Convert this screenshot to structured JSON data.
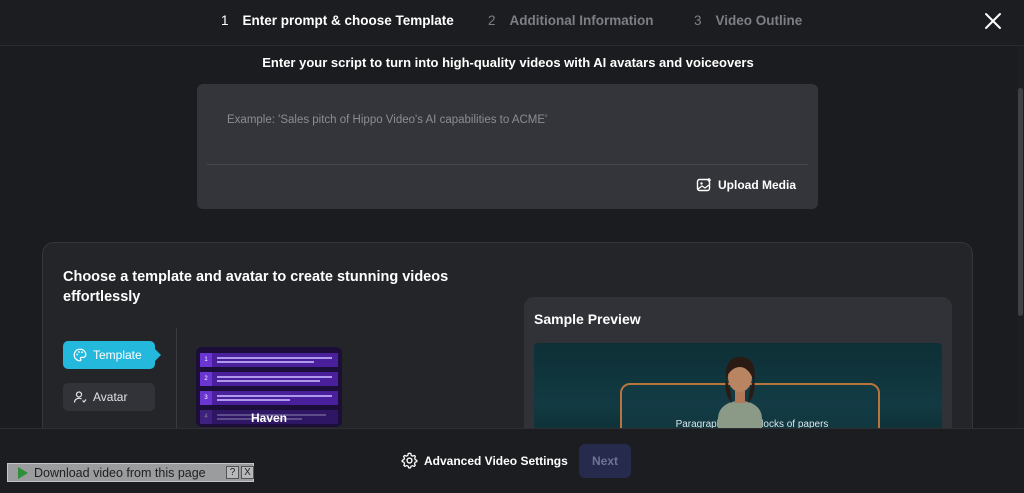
{
  "steps": [
    {
      "num": "1",
      "label": "Enter prompt & choose Template"
    },
    {
      "num": "2",
      "label": "Additional Information"
    },
    {
      "num": "3",
      "label": "Video Outline"
    }
  ],
  "subtitle": "Enter your script to turn into high-quality videos with AI avatars and voiceovers",
  "prompt": {
    "placeholder": "Example: 'Sales pitch of Hippo Video's AI capabilities to ACME'",
    "upload_label": "Upload Media"
  },
  "panel": {
    "title": "Choose a template and avatar to create stunning videos effortlessly",
    "tabs": [
      {
        "label": "Template",
        "icon": "palette-icon",
        "active": true
      },
      {
        "label": "Avatar",
        "icon": "person-icon",
        "active": false
      }
    ],
    "templates": [
      {
        "name": "Haven",
        "row_numbers": [
          "1",
          "2",
          "3",
          "4"
        ]
      }
    ],
    "preview": {
      "title": "Sample Preview",
      "video_caption": "Paragraphs are t... locks of papers"
    }
  },
  "bottom": {
    "advanced_label": "Advanced Video Settings",
    "next_label": "Next"
  },
  "download_bar": {
    "label": "Download video from this page",
    "help": "?",
    "close": "X"
  },
  "colors": {
    "background": "#1b1c1f",
    "accent": "#24b8dc",
    "next_disabled": "#262a4d"
  }
}
